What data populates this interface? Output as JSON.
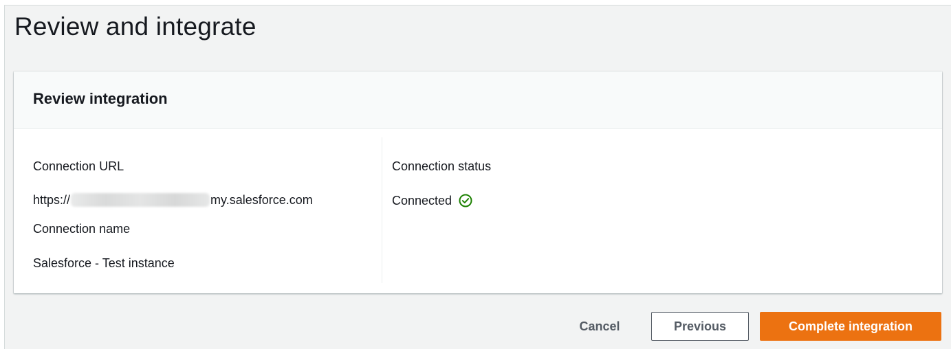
{
  "page": {
    "title": "Review and integrate"
  },
  "panel": {
    "title": "Review integration",
    "left": {
      "connection_url_label": "Connection URL",
      "connection_url_prefix": "https://",
      "connection_url_suffix": "my.salesforce.com",
      "connection_name_label": "Connection name",
      "connection_name_value": "Salesforce - Test instance"
    },
    "right": {
      "connection_status_label": "Connection status",
      "connection_status_value": "Connected",
      "status_icon": "check-circle-icon",
      "status_color": "#1d8102"
    }
  },
  "footer": {
    "cancel_label": "Cancel",
    "previous_label": "Previous",
    "complete_label": "Complete integration"
  },
  "colors": {
    "primary_button": "#ec7211",
    "page_background": "#f2f3f3",
    "panel_header_background": "#f8fafa"
  }
}
